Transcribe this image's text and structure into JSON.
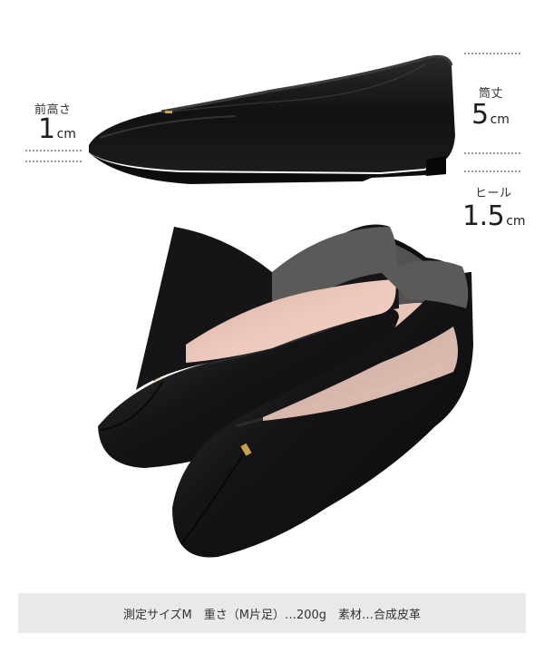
{
  "measurements": {
    "toe_height": {
      "label": "前高さ",
      "value": "1",
      "unit": "cm"
    },
    "shaft_height": {
      "label": "筒丈",
      "value": "5",
      "unit": "cm"
    },
    "heel_height": {
      "label": "ヒール",
      "value": "1.5",
      "unit": "cm"
    }
  },
  "footer": {
    "text": "測定サイズM　重さ（M片足）…200g　素材…合成皮革"
  },
  "colors": {
    "shoe": "#161616",
    "insole": "#e7c2b4",
    "footer_bg": "#e9e9ea"
  }
}
